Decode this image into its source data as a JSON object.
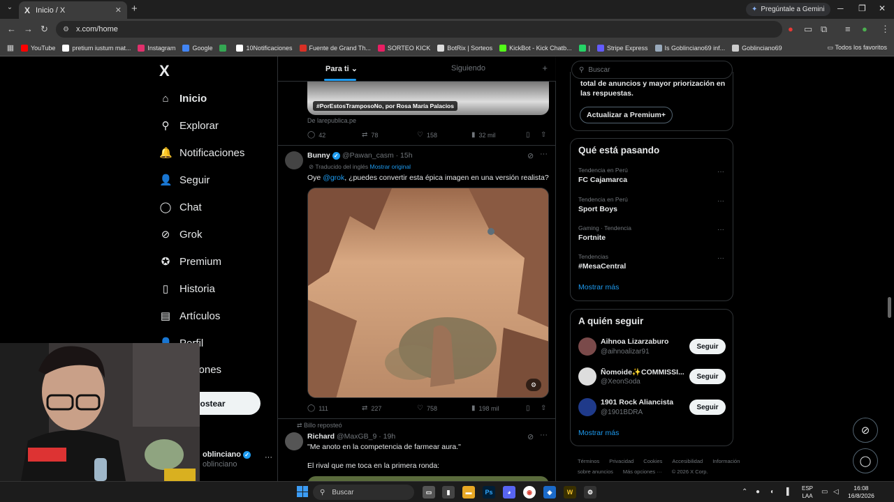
{
  "browser": {
    "tab_title": "Inicio / X",
    "tab_logo": "X",
    "close_glyph": "✕",
    "new_tab_glyph": "+",
    "tab_list_glyph": "⌄",
    "gemini_label": "Pregúntale a Gemini",
    "url": "x.com/home",
    "all_favorites": "Todos los favoritos",
    "bookmarks": [
      {
        "label": "YouTube",
        "color": "#ff0000"
      },
      {
        "label": "pretium iustum mat...",
        "color": "#ffffff"
      },
      {
        "label": "Instagram",
        "color": "#e1306c"
      },
      {
        "label": "Google",
        "color": "#4285f4"
      },
      {
        "label": "",
        "color": "#34a853"
      },
      {
        "label": "10Notificaciones",
        "color": "#ffffff"
      },
      {
        "label": "Fuente de Grand Th...",
        "color": "#d93025"
      },
      {
        "label": "SORTEO KICK",
        "color": "#e91e63"
      },
      {
        "label": "BotRix | Sorteos",
        "color": "#dddddd"
      },
      {
        "label": "KickBot - Kick Chatb...",
        "color": "#53fc18"
      },
      {
        "label": "|",
        "color": "#25d366"
      },
      {
        "label": "Stripe Express",
        "color": "#635bff"
      },
      {
        "label": "Is Goblinciano69 inf...",
        "color": "#9ab"
      },
      {
        "label": "Goblinciano69",
        "color": "#ccc"
      }
    ]
  },
  "nav": {
    "logo": "X",
    "items": [
      {
        "label": "Inicio",
        "icon": "⌂"
      },
      {
        "label": "Explorar",
        "icon": "⚲"
      },
      {
        "label": "Notificaciones",
        "icon": "🔔"
      },
      {
        "label": "Seguir",
        "icon": "👤"
      },
      {
        "label": "Chat",
        "icon": "◯"
      },
      {
        "label": "Grok",
        "icon": "⊘"
      },
      {
        "label": "Premium",
        "icon": "✪"
      },
      {
        "label": "Historia",
        "icon": "▯"
      },
      {
        "label": "Artículos",
        "icon": "▤"
      },
      {
        "label": "Perfil",
        "icon": "👤"
      },
      {
        "label": "opciones",
        "icon": "⋯"
      }
    ],
    "post_button": "ostear",
    "account_name": "oblinciano",
    "account_handle": "oblinciano",
    "account_more": "···"
  },
  "timeline": {
    "tab_for_you": "Para ti",
    "tab_following": "Siguiendo",
    "tab_plus": "+",
    "post1": {
      "image_caption": "#PorEstosTramposoNo, por Rosa María Palacios",
      "source": "De larepublica.pe",
      "replies": "42",
      "reposts": "78",
      "likes": "158",
      "views": "32 mil"
    },
    "post2": {
      "name": "Bunny",
      "handle": "@Pawan_casm · 15h",
      "translated": "Traducido del inglés",
      "show_original": "Mostrar original",
      "text_before": "Oye ",
      "mention": "@grok",
      "text_after": ", ¿puedes convertir esta épica imagen en una versión realista?",
      "replies": "111",
      "reposts": "227",
      "likes": "758",
      "views": "198 mil"
    },
    "post3": {
      "reposted_by": "Billo reposteó",
      "name": "Richard",
      "handle": "@MaxGB_9 · 19h",
      "line1": "\"Me anoto en la competencia de farmear aura.\"",
      "line2": "El rival que me toca en la primera ronda:"
    }
  },
  "sidebar": {
    "search_placeholder": "Buscar",
    "premium_text": "total de anuncios y mayor priorización en las respuestas.",
    "premium_button": "Actualizar a Premium+",
    "trends_title": "Qué está pasando",
    "trends": [
      {
        "context": "Tendencia en Perú",
        "name": "FC Cajamarca"
      },
      {
        "context": "Tendencia en Perú",
        "name": "Sport Boys"
      },
      {
        "context": "Gaming · Tendencia",
        "name": "Fortnite"
      },
      {
        "context": "Tendencias",
        "name": "#MesaCentral"
      }
    ],
    "trends_more": "···",
    "show_more": "Mostrar más",
    "follow_title": "A quién seguir",
    "follow": [
      {
        "name": "Aihnoa Lizarzaburo",
        "handle": "@aihnoalizar91",
        "button": "Seguir"
      },
      {
        "name": "Ñomoide✨COMMISSI...",
        "handle": "@XeonSoda",
        "button": "Seguir"
      },
      {
        "name": "1901 Rock Aliancista",
        "handle": "@1901BDRA",
        "button": "Seguir"
      }
    ],
    "follow_more": "Mostrar más",
    "footer": [
      "Términos",
      "Privacidad",
      "Cookies",
      "Accesibilidad",
      "Información sobre anuncios",
      "Más opciones ···",
      "© 2026 X Corp."
    ]
  },
  "taskbar": {
    "search": "Buscar",
    "lang_top": "ESP",
    "lang_bottom": "LAA",
    "time": "16:08",
    "date": "16/8/2026"
  }
}
